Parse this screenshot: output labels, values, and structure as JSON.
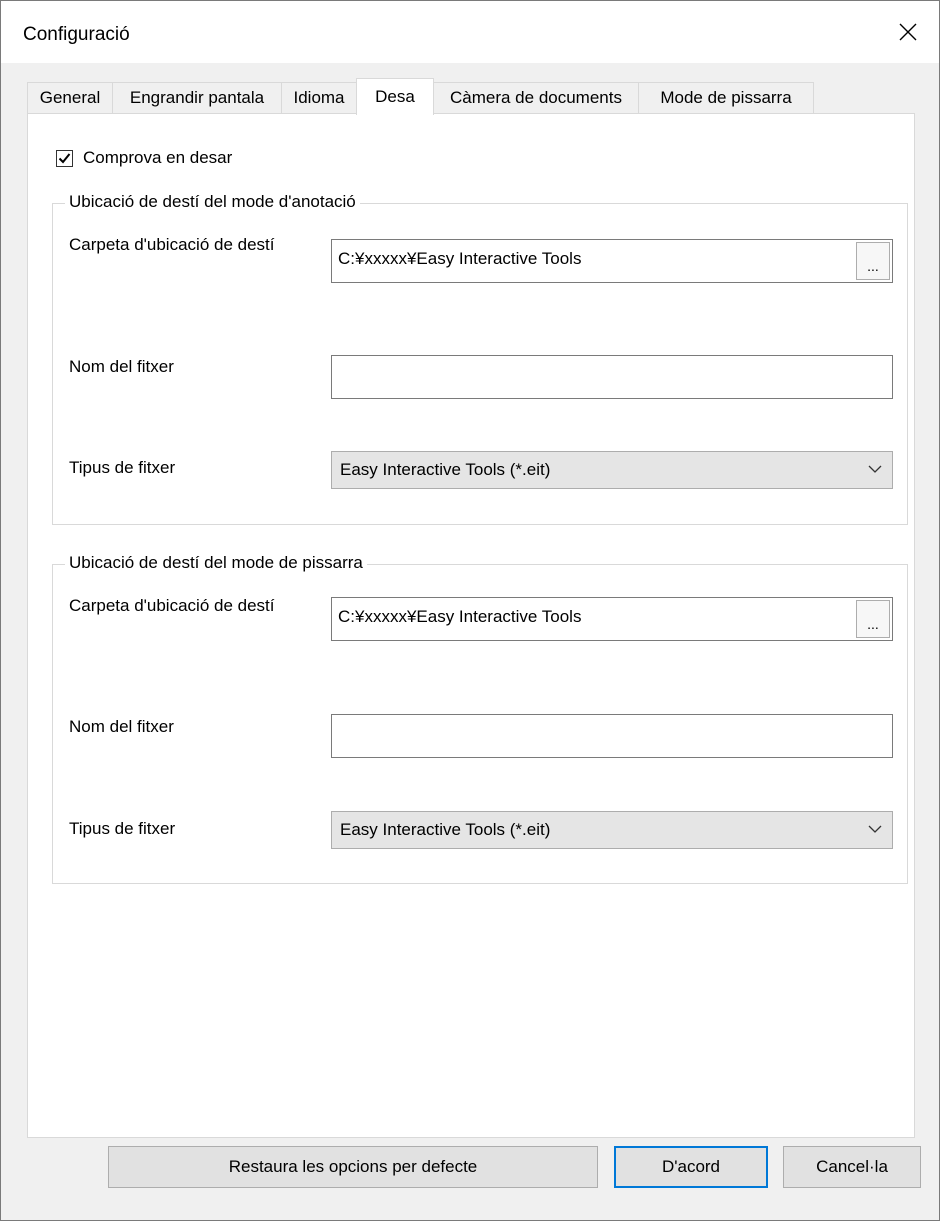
{
  "window": {
    "title": "Configuració"
  },
  "tabs": [
    {
      "label": "General"
    },
    {
      "label": "Engrandir pantala"
    },
    {
      "label": "Idioma"
    },
    {
      "label": "Desa"
    },
    {
      "label": "Càmera de documents"
    },
    {
      "label": "Mode de pissarra"
    }
  ],
  "active_tab": "Desa",
  "check_on_save": {
    "label": "Comprova en desar",
    "checked": true
  },
  "annotation_group": {
    "title": "Ubicació de destí del mode d'anotació",
    "folder_label": "Carpeta d'ubicació de destí",
    "folder_value": "C:¥xxxxx¥Easy Interactive Tools",
    "browse_label": "...",
    "filename_label": "Nom del fitxer",
    "filename_value": "",
    "filetype_label": "Tipus de fitxer",
    "filetype_value": "Easy Interactive Tools (*.eit)"
  },
  "whiteboard_group": {
    "title": "Ubicació de destí del mode de pissarra",
    "folder_label": "Carpeta d'ubicació de destí",
    "folder_value": "C:¥xxxxx¥Easy Interactive Tools",
    "browse_label": "...",
    "filename_label": "Nom del fitxer",
    "filename_value": "",
    "filetype_label": "Tipus de fitxer",
    "filetype_value": "Easy Interactive Tools (*.eit)"
  },
  "buttons": {
    "restore": "Restaura les opcions per defecte",
    "ok": "D'acord",
    "cancel": "Cancel·la"
  },
  "colors": {
    "accent": "#0078d7",
    "panel": "#ffffff",
    "background": "#f0f0f0"
  }
}
